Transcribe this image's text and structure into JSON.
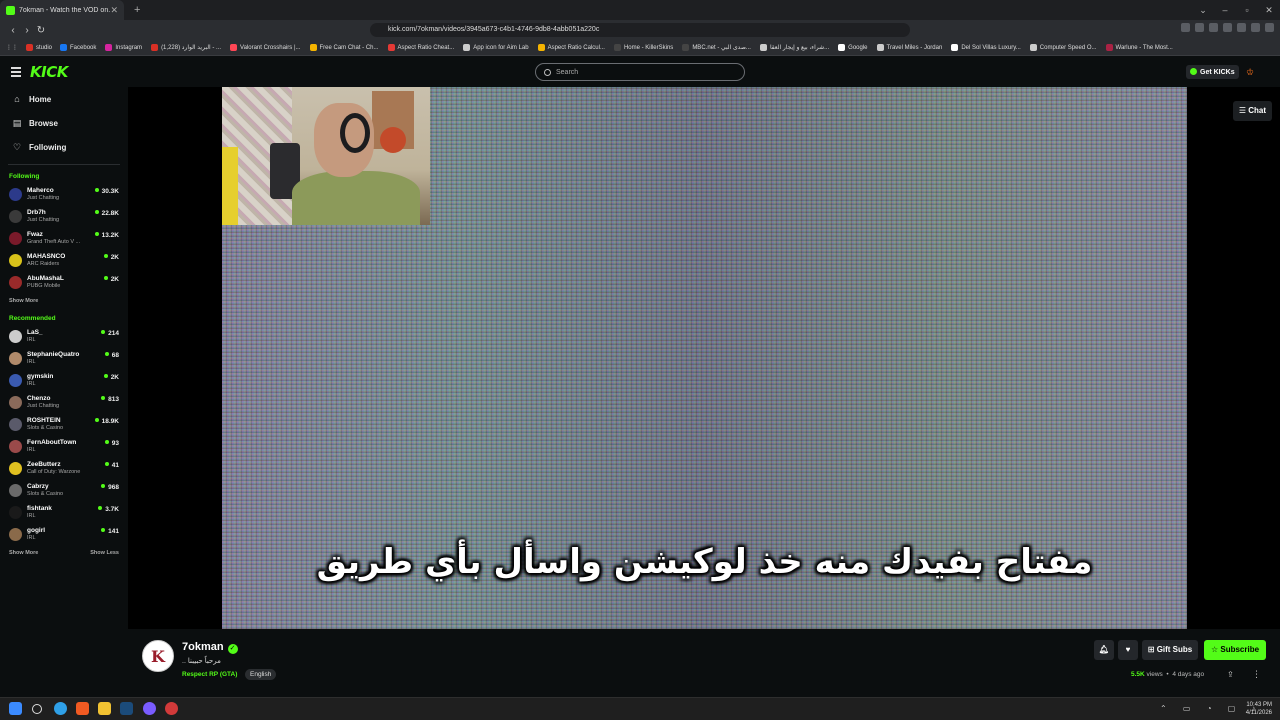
{
  "browser": {
    "tab_title": "7okman - Watch the VOD on...",
    "url": "kick.com/7okman/videos/3945a673-c4b1-4746-9db8-4abb051a220c",
    "bookmarks": [
      {
        "label": "Facebook",
        "color": "#1877f2"
      },
      {
        "label": "Instagram",
        "color": "#d6249f"
      },
      {
        "label": "(1,228) البريد الوارد - ...",
        "color": "#d93025"
      },
      {
        "label": "Valorant Crosshairs |...",
        "color": "#ff4655"
      },
      {
        "label": "Free Cam Chat - Ch...",
        "color": "#f5b400"
      },
      {
        "label": "Aspect Ratio Cheat...",
        "color": "#e53935"
      },
      {
        "label": "App icon for Aim Lab",
        "color": "#cccccc"
      },
      {
        "label": "Aspect Ratio Calcul...",
        "color": "#f5b400"
      },
      {
        "label": "Home - KillerSkins",
        "color": "#444444"
      },
      {
        "label": "MBC.net - صدى البي...",
        "color": "#444444"
      },
      {
        "label": "شراء، بيع و إيجار العقا...",
        "color": "#cccccc"
      },
      {
        "label": "Google",
        "color": "#ffffff"
      },
      {
        "label": "Travel Miles - Jordan",
        "color": "#cccccc"
      },
      {
        "label": "Del Sol Villas Luxury...",
        "color": "#ffffff"
      },
      {
        "label": "Computer Speed O...",
        "color": "#cccccc"
      },
      {
        "label": "Warlune - The Most...",
        "color": "#aa2244"
      }
    ],
    "studio_label": "studio"
  },
  "header": {
    "logo": "KICK",
    "search_placeholder": "Search",
    "get_kicks": "Get KICKs"
  },
  "sidebar": {
    "nav": [
      {
        "label": "Home",
        "icon": "home-icon",
        "glyph": "⌂"
      },
      {
        "label": "Browse",
        "icon": "browse-icon",
        "glyph": "▤"
      },
      {
        "label": "Following",
        "icon": "heart-icon",
        "glyph": "♡"
      }
    ],
    "following_title": "Following",
    "following": [
      {
        "name": "Maherco",
        "category": "Just Chatting",
        "viewers": "30.3K",
        "color": "#2c3a8a"
      },
      {
        "name": "Drb7h",
        "category": "Just Chatting",
        "viewers": "22.8K",
        "color": "#3a3a3a"
      },
      {
        "name": "Fwaz",
        "category": "Grand Theft Auto V ...",
        "viewers": "13.2K",
        "color": "#7a1a2a"
      },
      {
        "name": "MAHASNCO",
        "category": "ARC Raiders",
        "viewers": "2K",
        "color": "#d8c21a"
      },
      {
        "name": "AbuMashaL",
        "category": "PUBG Mobile",
        "viewers": "2K",
        "color": "#9a2a2a"
      }
    ],
    "show_more_1": "Show More",
    "recommended_title": "Recommended",
    "recommended": [
      {
        "name": "LaS_",
        "category": "IRL",
        "viewers": "214",
        "color": "#cccccc"
      },
      {
        "name": "StephanieQuatro",
        "category": "IRL",
        "viewers": "68",
        "color": "#b08a6a"
      },
      {
        "name": "gymskin",
        "category": "IRL",
        "viewers": "2K",
        "color": "#3a5ab0"
      },
      {
        "name": "Chenzo",
        "category": "Just Chatting",
        "viewers": "813",
        "color": "#8a6a5a"
      },
      {
        "name": "ROSHTEIN",
        "category": "Slots & Casino",
        "viewers": "18.9K",
        "color": "#5a5a6a"
      },
      {
        "name": "FernAboutTown",
        "category": "IRL",
        "viewers": "93",
        "color": "#9a4a4a"
      },
      {
        "name": "ZeeButterz",
        "category": "Call of Duty: Warzone",
        "viewers": "41",
        "color": "#e0c020"
      },
      {
        "name": "Cabrzy",
        "category": "Slots & Casino",
        "viewers": "968",
        "color": "#6a6a6a"
      },
      {
        "name": "fishtank",
        "category": "IRL",
        "viewers": "3.7K",
        "color": "#1a1a1a"
      },
      {
        "name": "gogirl",
        "category": "IRL",
        "viewers": "141",
        "color": "#8a6a4a"
      }
    ],
    "show_more_2": "Show More",
    "show_less": "Show Less"
  },
  "player": {
    "subtitle": "مفتاح بفيدك منه خذ لوكيشن واسأل بأي طريق",
    "chat_button": "Chat"
  },
  "info": {
    "channel_name": "7okman",
    "stream_title": "مرحباً حبيبنا ..",
    "category": "Respect RP (GTA)",
    "language": "English",
    "gift_subs": "Gift Subs",
    "subscribe": "Subscribe",
    "views_count": "5.5K",
    "views_label": "views",
    "age": "4 days ago"
  },
  "taskbar": {
    "time": "10:43 PM",
    "date": "4/11/2026"
  }
}
